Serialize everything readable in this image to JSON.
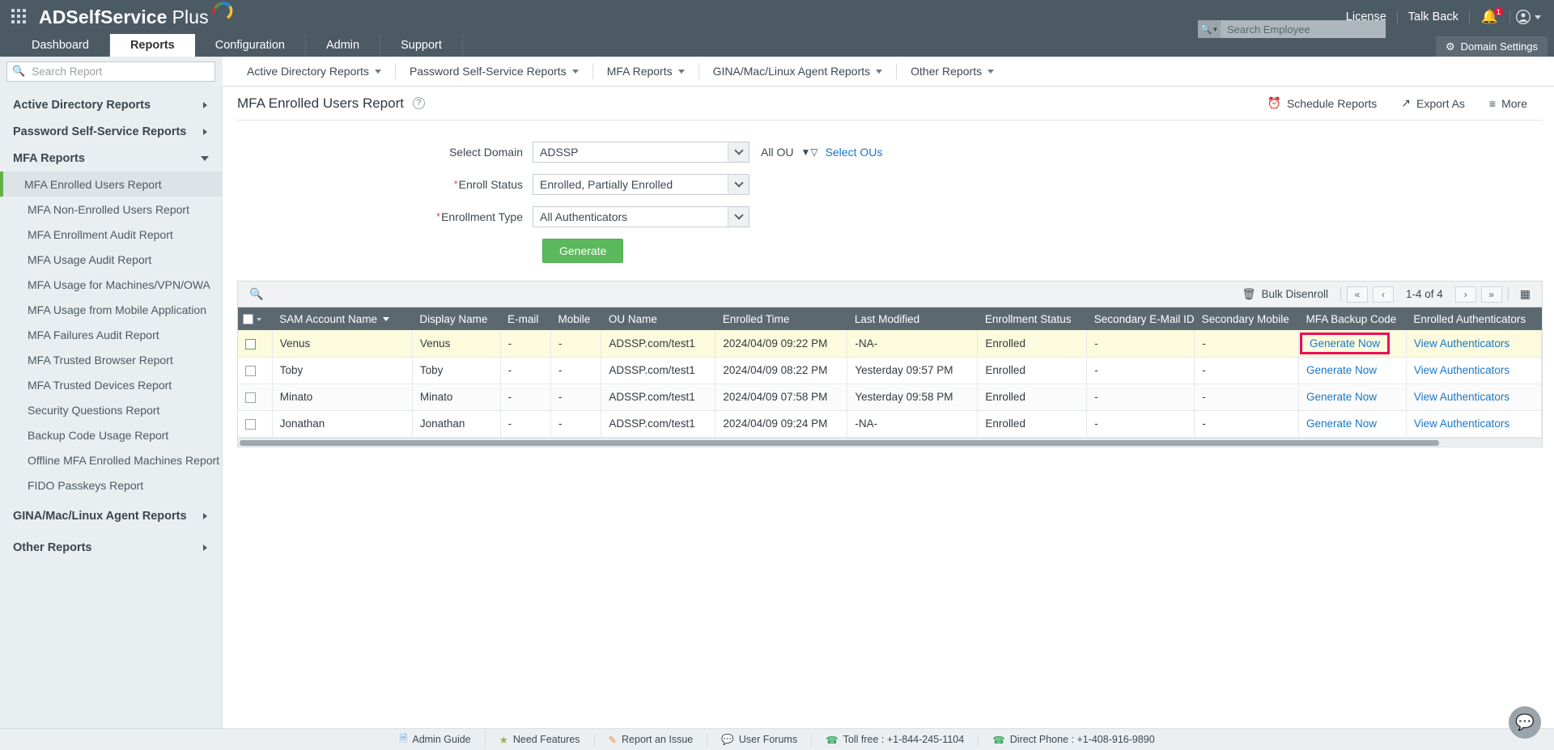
{
  "header": {
    "brand_bold": "ADSelfService",
    "brand_light": "Plus",
    "license": "License",
    "talk_back": "Talk Back",
    "notification_count": "1",
    "grid_icon": "apps-grid-icon",
    "bell_icon": "bell-icon",
    "user_icon": "user-avatar-icon"
  },
  "tabs": [
    {
      "label": "Dashboard",
      "active": false
    },
    {
      "label": "Reports",
      "active": true
    },
    {
      "label": "Configuration",
      "active": false
    },
    {
      "label": "Admin",
      "active": false
    },
    {
      "label": "Support",
      "active": false
    }
  ],
  "search_employee": {
    "placeholder": "Search Employee",
    "value": "",
    "icon": "search-icon"
  },
  "domain_settings": {
    "label": "Domain Settings",
    "icon": "gear-icon"
  },
  "search_report": {
    "placeholder": "Search Report",
    "value": "",
    "icon": "search-icon"
  },
  "subnav": [
    {
      "label": "Active Directory Reports"
    },
    {
      "label": "Password Self-Service Reports"
    },
    {
      "label": "MFA Reports"
    },
    {
      "label": "GINA/Mac/Linux Agent Reports"
    },
    {
      "label": "Other Reports"
    }
  ],
  "sidebar": {
    "groups": [
      {
        "label": "Active Directory Reports",
        "state": "collapsed"
      },
      {
        "label": "Password Self-Service Reports",
        "state": "collapsed"
      },
      {
        "label": "MFA Reports",
        "state": "expanded"
      }
    ],
    "mfa_items": [
      {
        "label": "MFA Enrolled Users Report",
        "selected": true
      },
      {
        "label": "MFA Non-Enrolled Users Report",
        "selected": false
      },
      {
        "label": "MFA Enrollment Audit Report",
        "selected": false
      },
      {
        "label": "MFA Usage Audit Report",
        "selected": false
      },
      {
        "label": "MFA Usage for Machines/VPN/OWA",
        "selected": false
      },
      {
        "label": "MFA Usage from Mobile Application",
        "selected": false
      },
      {
        "label": "MFA Failures Audit Report",
        "selected": false
      },
      {
        "label": "MFA Trusted Browser Report",
        "selected": false
      },
      {
        "label": "MFA Trusted Devices Report",
        "selected": false
      },
      {
        "label": "Security Questions Report",
        "selected": false
      },
      {
        "label": "Backup Code Usage Report",
        "selected": false
      },
      {
        "label": "Offline MFA Enrolled Machines Report",
        "selected": false
      },
      {
        "label": "FIDO Passkeys Report",
        "selected": false
      }
    ],
    "bottom_groups": [
      {
        "label": "GINA/Mac/Linux Agent Reports",
        "state": "collapsed"
      },
      {
        "label": "Other Reports",
        "state": "collapsed"
      }
    ]
  },
  "page": {
    "title": "MFA Enrolled Users Report",
    "help_icon": "question-mark-icon",
    "actions": [
      {
        "label": "Schedule Reports",
        "icon": "alarm-clock-icon"
      },
      {
        "label": "Export As",
        "icon": "export-icon"
      },
      {
        "label": "More",
        "icon": "more-icon"
      }
    ]
  },
  "form": {
    "select_domain": {
      "label": "Select Domain",
      "value": "ADSSP",
      "required": false
    },
    "enroll_status": {
      "label": "Enroll Status",
      "value": "Enrolled, Partially Enrolled",
      "required": true
    },
    "enrollment_type": {
      "label": "Enrollment Type",
      "value": "All Authenticators",
      "required": true
    },
    "ou": {
      "all_ou_label": "All OU",
      "filter_icon": "funnel-icon",
      "select_ous_link": "Select OUs"
    },
    "generate_button": "Generate"
  },
  "table_toolbar": {
    "search_icon": "search-icon",
    "bulk_disenroll": "Bulk Disenroll",
    "bulk_icon": "bulk-disenroll-icon",
    "first_page": "«",
    "prev_page": "‹",
    "page_info": "1-4 of 4",
    "next_page": "›",
    "last_page": "»",
    "column_chooser_icon": "column-settings-icon"
  },
  "table": {
    "columns": [
      "SAM Account Name",
      "Display Name",
      "E-mail",
      "Mobile",
      "OU Name",
      "Enrolled Time",
      "Last Modified",
      "Enrollment Status",
      "Secondary E-Mail ID",
      "Secondary Mobile",
      "MFA Backup Code",
      "Enrolled Authenticators"
    ],
    "sorted_column": "SAM Account Name",
    "rows": [
      {
        "sam_account_name": "Venus",
        "display_name": "Venus",
        "email": "-",
        "mobile": "-",
        "ou_name": "ADSSP.com/test1",
        "enrolled_time": "2024/04/09 09:22 PM",
        "last_modified": "-NA-",
        "enrollment_status": "Enrolled",
        "secondary_email": "-",
        "secondary_mobile": "-",
        "backup_code": "Generate Now",
        "authenticators": "View Authenticators",
        "highlighted": true,
        "backup_code_focused": true
      },
      {
        "sam_account_name": "Toby",
        "display_name": "Toby",
        "email": "-",
        "mobile": "-",
        "ou_name": "ADSSP.com/test1",
        "enrolled_time": "2024/04/09 08:22 PM",
        "last_modified": "Yesterday 09:57 PM",
        "enrollment_status": "Enrolled",
        "secondary_email": "-",
        "secondary_mobile": "-",
        "backup_code": "Generate Now",
        "authenticators": "View Authenticators",
        "highlighted": false,
        "backup_code_focused": false
      },
      {
        "sam_account_name": "Minato",
        "display_name": "Minato",
        "email": "-",
        "mobile": "-",
        "ou_name": "ADSSP.com/test1",
        "enrolled_time": "2024/04/09 07:58 PM",
        "last_modified": "Yesterday 09:58 PM",
        "enrollment_status": "Enrolled",
        "secondary_email": "-",
        "secondary_mobile": "-",
        "backup_code": "Generate Now",
        "authenticators": "View Authenticators",
        "highlighted": false,
        "backup_code_focused": false
      },
      {
        "sam_account_name": "Jonathan",
        "display_name": "Jonathan",
        "email": "-",
        "mobile": "-",
        "ou_name": "ADSSP.com/test1",
        "enrolled_time": "2024/04/09 09:24 PM",
        "last_modified": "-NA-",
        "enrollment_status": "Enrolled",
        "secondary_email": "-",
        "secondary_mobile": "-",
        "backup_code": "Generate Now",
        "authenticators": "View Authenticators",
        "highlighted": false,
        "backup_code_focused": false
      }
    ]
  },
  "footer": [
    {
      "label": "Admin Guide",
      "icon": "book-icon",
      "color": "#4a9fd4"
    },
    {
      "label": "Need Features",
      "icon": "idea-icon",
      "color": "#8fb73e"
    },
    {
      "label": "Report an Issue",
      "icon": "bug-icon",
      "color": "#e8903a"
    },
    {
      "label": "User Forums",
      "icon": "forum-icon",
      "color": "#d44a5a"
    },
    {
      "label": "Toll free : +1-844-245-1104",
      "icon": "phone-icon",
      "color": "#3aab63"
    },
    {
      "label": "Direct Phone : +1-408-916-9890",
      "icon": "phone-icon",
      "color": "#3aab63"
    }
  ],
  "chat": {
    "icon": "chat-bubble-icon"
  },
  "colors": {
    "brand_dark": "#4c5a64",
    "accent_green": "#5cb85c",
    "link_blue": "#1a76c7",
    "highlight_row": "#fcfbdd",
    "focus_outline": "#ef0b55",
    "table_header": "#5b6870"
  }
}
